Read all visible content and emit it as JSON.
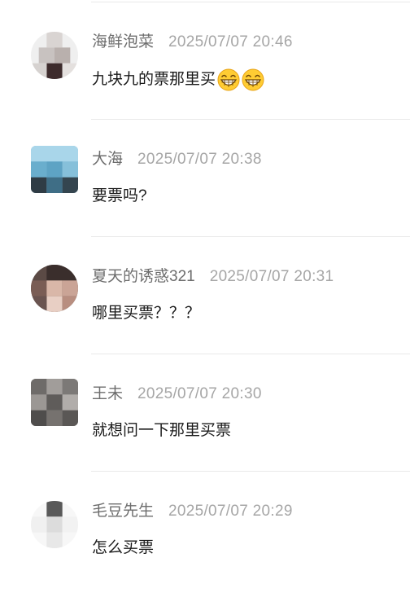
{
  "comments": [
    {
      "username": "海鲜泡菜",
      "time": "2025/07/07 20:46",
      "text": "九块九的票那里买",
      "emojis": [
        "grinning-face-icon",
        "grinning-face-icon"
      ]
    },
    {
      "username": "大海",
      "time": "2025/07/07 20:38",
      "text": "要票吗?",
      "emojis": []
    },
    {
      "username": "夏天的诱惑321",
      "time": "2025/07/07 20:31",
      "text": "哪里买票？？？",
      "emojis": []
    },
    {
      "username": "王未",
      "time": "2025/07/07 20:30",
      "text": "就想问一下那里买票",
      "emojis": []
    },
    {
      "username": "毛豆先生",
      "time": "2025/07/07 20:29",
      "text": "怎么买票",
      "emojis": []
    }
  ],
  "colors": {
    "username": "#6d6d6d",
    "timestamp": "#a6a6a6",
    "text": "#1a1a1a",
    "divider": "#e9e9e9"
  }
}
